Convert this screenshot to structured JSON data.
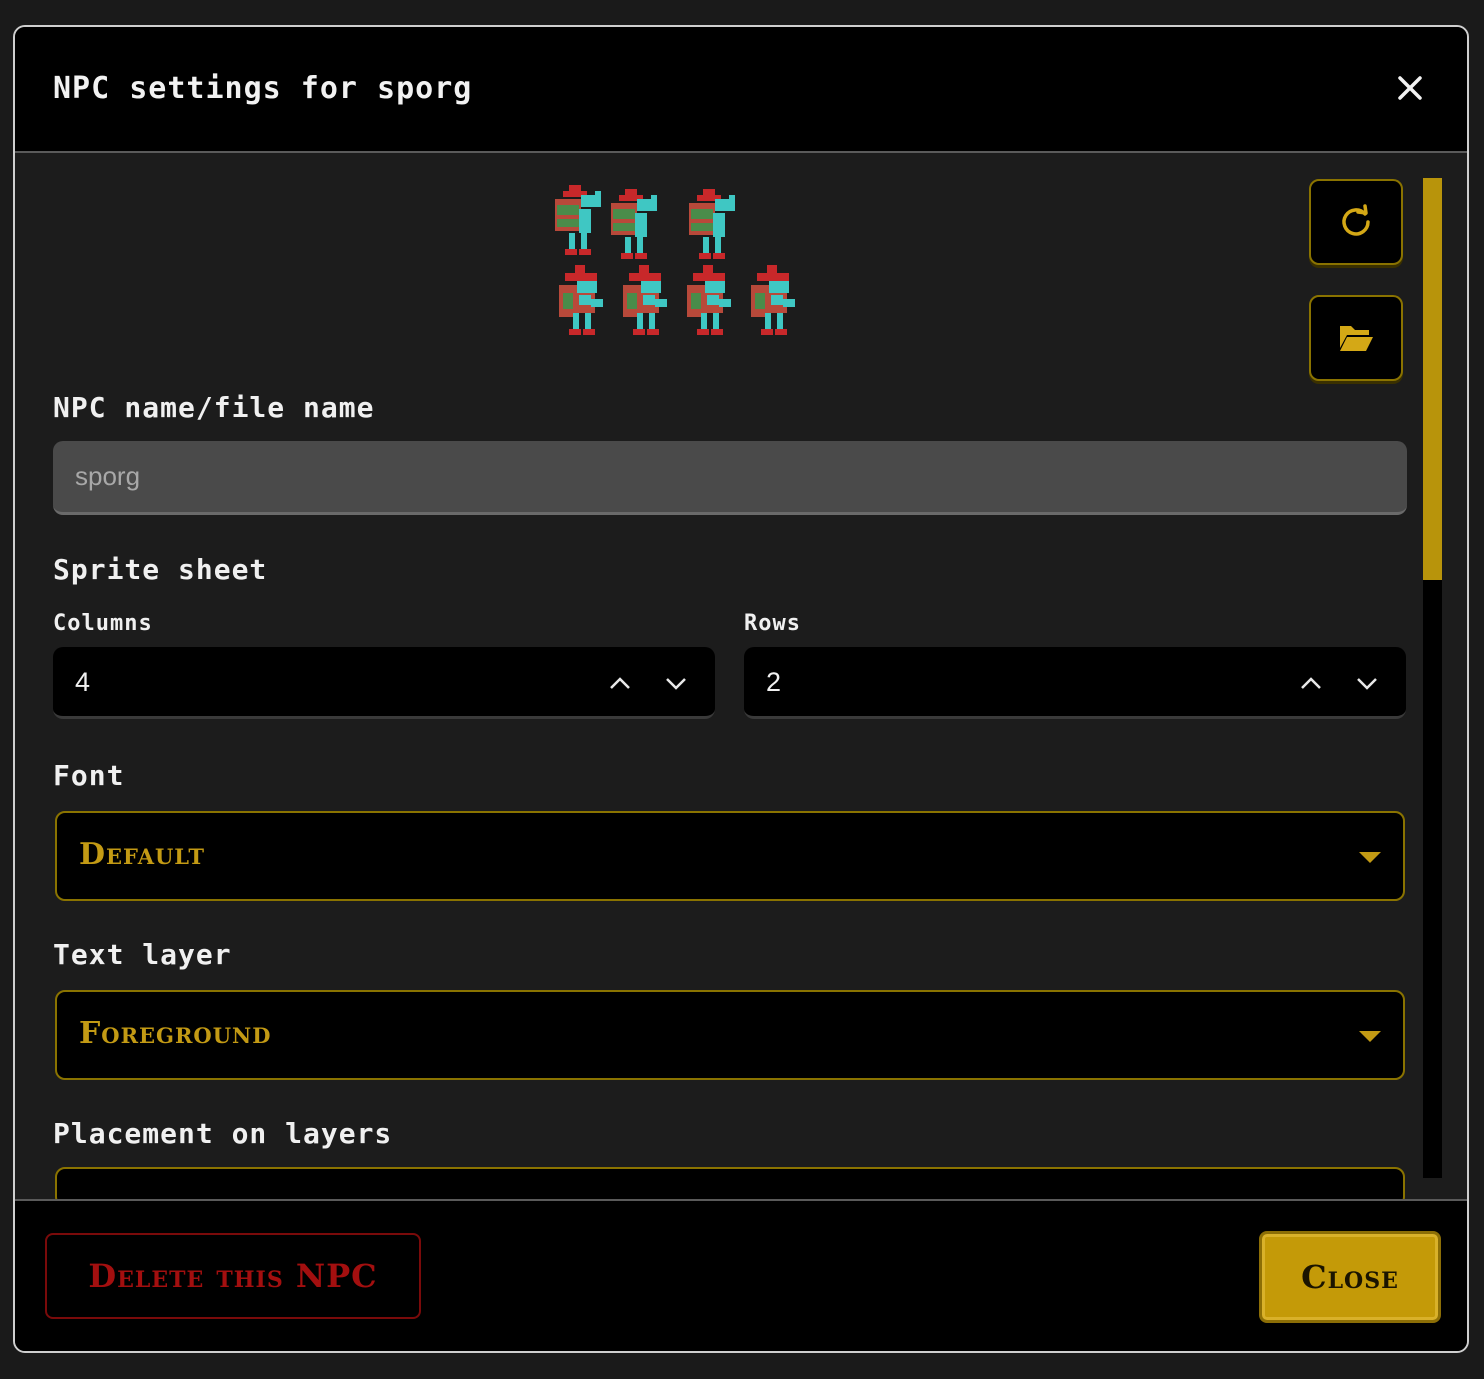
{
  "dialog": {
    "title": "NPC settings for sporg",
    "close_icon": "close-icon"
  },
  "sprite_preview": {
    "columns": 4,
    "rows": 2,
    "colors": {
      "hat": "#c8282a",
      "skin": "#3fc7c3",
      "pack": "#4a8c4a",
      "body": "#b8493a"
    }
  },
  "actions": {
    "reload_icon": "refresh-icon",
    "open_folder_icon": "folder-open-icon"
  },
  "name_field": {
    "label": "NPC name/file name",
    "value": "sporg"
  },
  "sprite_sheet": {
    "heading": "Sprite sheet",
    "columns_label": "Columns",
    "columns_value": "4",
    "rows_label": "Rows",
    "rows_value": "2"
  },
  "font": {
    "label": "Font",
    "selected": "Default"
  },
  "text_layer": {
    "label": "Text layer",
    "selected": "Foreground"
  },
  "placement": {
    "label": "Placement on layers"
  },
  "footer": {
    "delete_label": "Delete this NPC",
    "close_label": "Close"
  },
  "colors": {
    "accent": "#c49a08",
    "danger": "#a30f0f",
    "background": "#1c1c1c"
  }
}
